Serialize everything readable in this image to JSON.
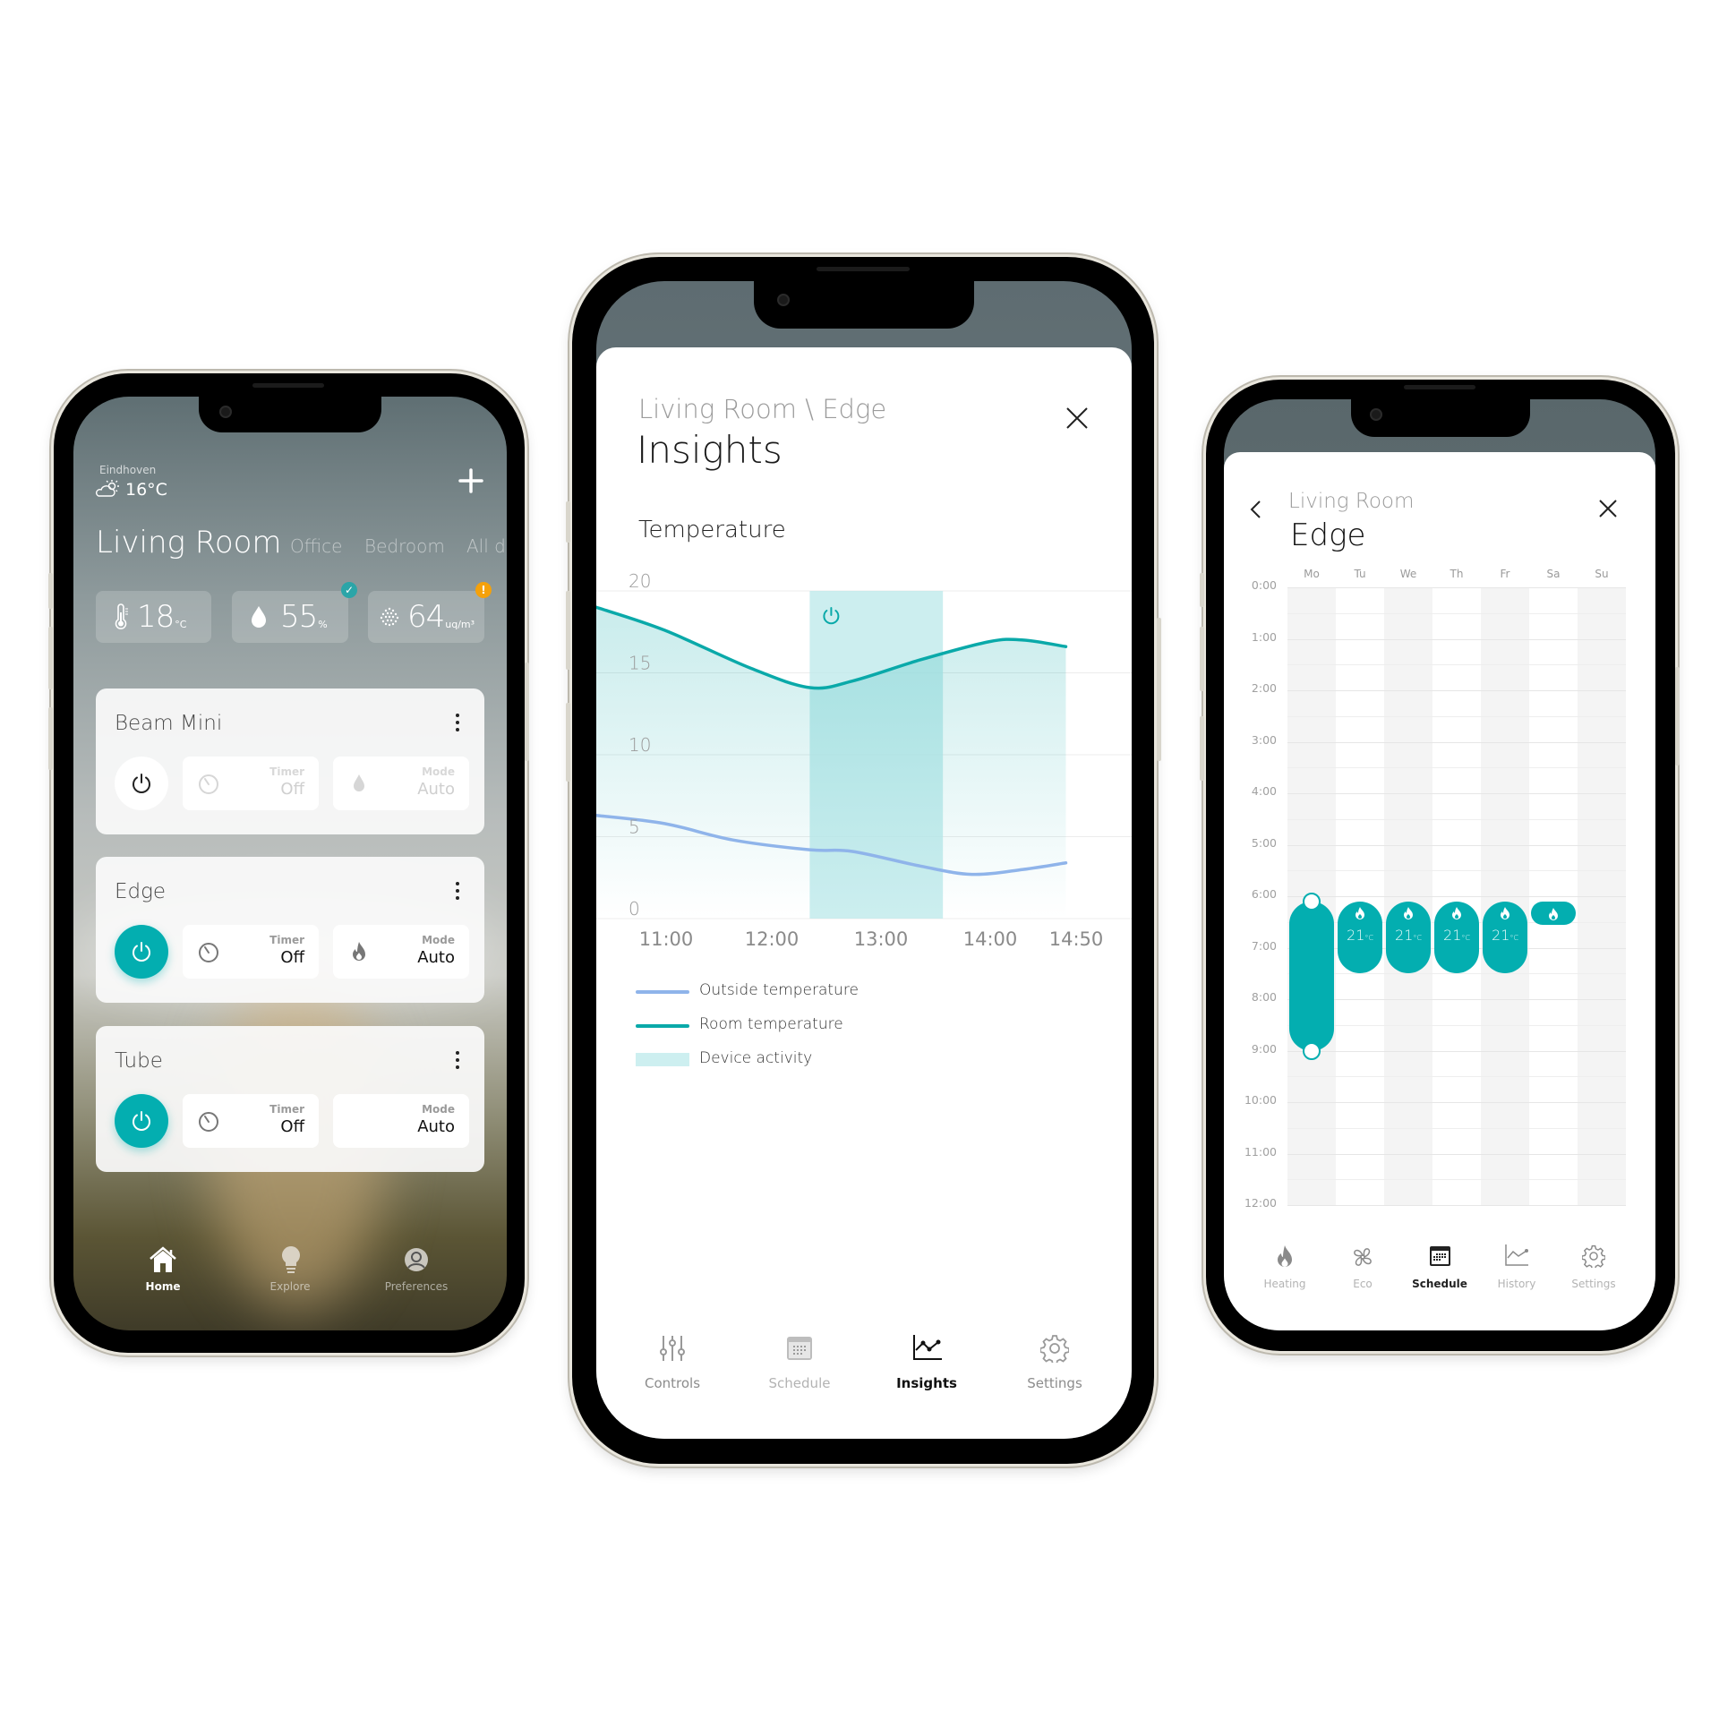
{
  "home_screen": {
    "weather": {
      "city": "Eindhoven",
      "temperature": "16°C",
      "icon": "partly-cloudy-icon"
    },
    "add_icon": "plus-icon",
    "rooms": [
      {
        "label": "Living Room",
        "active": true
      },
      {
        "label": "Office",
        "active": false
      },
      {
        "label": "Bedroom",
        "active": false
      },
      {
        "label": "All de",
        "active": false
      }
    ],
    "stats": [
      {
        "icon": "thermometer-icon",
        "value": "18",
        "unit": "°C",
        "badge": null
      },
      {
        "icon": "droplet-icon",
        "value": "55",
        "unit": "%",
        "badge": "check",
        "badge_color": "#2ba5a8"
      },
      {
        "icon": "particles-icon",
        "value": "64",
        "unit": "uq/m³",
        "badge": "!",
        "badge_color": "#f5a10a"
      }
    ],
    "devices": [
      {
        "name": "Beam Mini",
        "power_on": false,
        "timer_label": "Timer",
        "timer_value": "Off",
        "mode_label": "Mode",
        "mode_value": "Auto",
        "mode_icon": "droplet-icon",
        "enabled": false
      },
      {
        "name": "Edge",
        "power_on": true,
        "timer_label": "Timer",
        "timer_value": "Off",
        "mode_label": "Mode",
        "mode_value": "Auto",
        "mode_icon": "flame-icon",
        "enabled": true
      },
      {
        "name": "Tube",
        "power_on": true,
        "timer_label": "Timer",
        "timer_value": "Off",
        "mode_label": "Mode",
        "mode_value": "Auto",
        "mode_icon": null,
        "enabled": true
      }
    ],
    "nav": [
      {
        "label": "Home",
        "icon": "home-icon",
        "active": true
      },
      {
        "label": "Explore",
        "icon": "lightbulb-icon",
        "active": false
      },
      {
        "label": "Preferences",
        "icon": "user-icon",
        "active": false
      }
    ]
  },
  "insights_screen": {
    "breadcrumb": "Living Room \\ Edge",
    "title": "Insights",
    "section": "Temperature",
    "legend": [
      {
        "label": "Outside temperature",
        "color": "#8fb4ea"
      },
      {
        "label": "Room temperature",
        "color": "#0aa9a9"
      },
      {
        "label": "Device activity",
        "color": "#cdeff0"
      }
    ],
    "nav": [
      {
        "label": "Controls",
        "icon": "sliders-icon",
        "active": false
      },
      {
        "label": "Schedule",
        "icon": "calendar-icon",
        "active": false
      },
      {
        "label": "Insights",
        "icon": "chart-icon",
        "active": true
      },
      {
        "label": "Settings",
        "icon": "gear-icon",
        "active": false
      }
    ]
  },
  "chart_data": {
    "type": "line",
    "title": "Temperature",
    "xlabel": "",
    "ylabel": "",
    "ylim": [
      0,
      20
    ],
    "yticks": [
      0,
      5,
      10,
      15,
      20
    ],
    "xticks": [
      "11:00",
      "12:00",
      "13:00",
      "14:00",
      "14:50"
    ],
    "xrange_minutes": [
      610,
      890
    ],
    "grid": true,
    "legend_position": "bottom",
    "series": [
      {
        "name": "Room temperature",
        "color": "#0aa9a9",
        "x": [
          610,
          650,
          700,
          735,
          760,
          800,
          840,
          860,
          885
        ],
        "y": [
          19.0,
          17.6,
          15.3,
          14.1,
          14.5,
          15.8,
          16.9,
          17.0,
          16.6
        ]
      },
      {
        "name": "Outside temperature",
        "color": "#8fb4ea",
        "x": [
          610,
          650,
          690,
          735,
          760,
          800,
          830,
          860,
          885
        ],
        "y": [
          6.3,
          5.8,
          4.8,
          4.2,
          4.1,
          3.2,
          2.7,
          3.0,
          3.4
        ]
      }
    ],
    "activity": {
      "name": "Device activity",
      "start_minutes": 735,
      "end_minutes": 813
    }
  },
  "schedule_screen": {
    "room": "Living Room",
    "device": "Edge",
    "days": [
      "Mo",
      "Tu",
      "We",
      "Th",
      "Fr",
      "Sa",
      "Su"
    ],
    "hours": [
      "0:00",
      "1:00",
      "2:00",
      "3:00",
      "4:00",
      "5:00",
      "6:00",
      "7:00",
      "8:00",
      "9:00",
      "10:00",
      "11:00",
      "12:00"
    ],
    "blocks": [
      {
        "day": 0,
        "start": 6.1,
        "end": 9.0,
        "temp": "",
        "selected": true
      },
      {
        "day": 1,
        "start": 6.1,
        "end": 7.5,
        "temp": "21",
        "unit": "°C"
      },
      {
        "day": 2,
        "start": 6.1,
        "end": 7.5,
        "temp": "21",
        "unit": "°C"
      },
      {
        "day": 3,
        "start": 6.1,
        "end": 7.5,
        "temp": "21",
        "unit": "°C"
      },
      {
        "day": 4,
        "start": 6.1,
        "end": 7.5,
        "temp": "21",
        "unit": "°C"
      },
      {
        "day": 5,
        "start": 6.1,
        "end": 6.55,
        "temp": "",
        "unit": ""
      }
    ],
    "nav": [
      {
        "label": "Heating",
        "icon": "flame-icon",
        "active": false
      },
      {
        "label": "Eco",
        "icon": "fan-icon",
        "active": false
      },
      {
        "label": "Schedule",
        "icon": "calendar-icon",
        "active": true
      },
      {
        "label": "History",
        "icon": "chart-icon",
        "active": false
      },
      {
        "label": "Settings",
        "icon": "gear-icon",
        "active": false
      }
    ]
  }
}
